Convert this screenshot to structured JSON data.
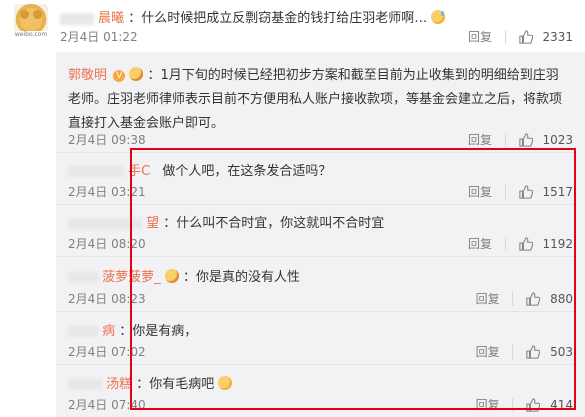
{
  "top": {
    "name": "晨曦",
    "text": "：什么时候把成立反剽窃基金的钱打给庄羽老师啊…",
    "date": "2月4日 01:22",
    "reply_label": "回复",
    "likes": "2331",
    "avatar_tag": "weibo.com"
  },
  "pinned_reply": {
    "author": "郭敬明",
    "text": "：1月下旬的时候已经把初步方案和截至目前为止收集到的明细给到庄羽老师。庄羽老师律师表示目前不方便用私人账户接收款项，等基金会建立之后，将款项直接打入基金会账户即可。",
    "date": "2月4日 09:38",
    "reply_label": "回复",
    "likes": "1023"
  },
  "replies": [
    {
      "name": "手C",
      "text": "做个人吧，在这条发合适吗？",
      "date": "2月4日 03:21",
      "reply_label": "回复",
      "likes": "1517"
    },
    {
      "name": "望",
      "text": "：什么叫不合时宜，你这就叫不合时宜",
      "date": "2月4日 08:20",
      "reply_label": "回复",
      "likes": "1192"
    },
    {
      "name": "菠萝菠萝_",
      "text": "：你是真的没有人性",
      "date": "2月4日 08:23",
      "reply_label": "回复",
      "likes": "880"
    },
    {
      "name": "病",
      "text": "：你是有病，",
      "date": "2月4日 07:02",
      "reply_label": "回复",
      "likes": "503"
    },
    {
      "name": "汤糕",
      "text": "：你有毛病吧",
      "date": "2月4日 07:40",
      "reply_label": "回复",
      "likes": "414"
    }
  ],
  "colors": {
    "name": "#eb7350",
    "highlight_border": "#e60012",
    "panel_bg": "#f2f2f5"
  },
  "icons": [
    "avatar",
    "sweat-emoji",
    "verified-badge",
    "angry-emoji",
    "thinking-emoji",
    "thumbs-up-icon"
  ]
}
